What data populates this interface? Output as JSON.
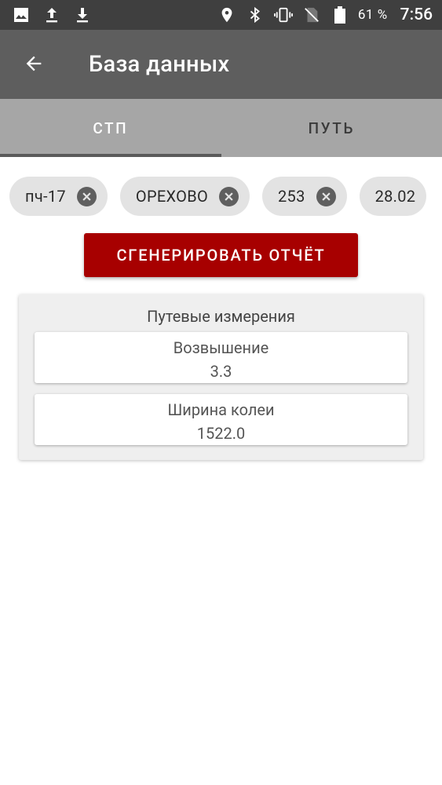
{
  "status_bar": {
    "battery_percent": "61 %",
    "time": "7:56",
    "icons": [
      "image-icon",
      "upload-icon",
      "download-icon",
      "location-icon",
      "bluetooth-icon",
      "vibrate-icon",
      "no-sim-icon",
      "battery-icon"
    ]
  },
  "app_bar": {
    "title": "База данных"
  },
  "tabs": [
    {
      "label": "СТП",
      "active": true
    },
    {
      "label": "ПУТЬ",
      "active": false
    }
  ],
  "chips": [
    {
      "label": "пч-17"
    },
    {
      "label": "ОРЕХОВО"
    },
    {
      "label": "253"
    },
    {
      "label": "28.02"
    }
  ],
  "generate_button": {
    "label": "СГЕНЕРИРОВАТЬ ОТЧЁТ"
  },
  "measurements": {
    "title": "Путевые измерения",
    "rows": [
      {
        "label": "Возвышение",
        "value": "3.3"
      },
      {
        "label": "Ширина колеи",
        "value": "1522.0"
      }
    ]
  },
  "colors": {
    "status_bar": "#3f3f3f",
    "app_bar": "#5e5e5e",
    "tabs": "#a6a6a6",
    "accent_button": "#a70000",
    "chip_bg": "#e3e3e3",
    "card_bg": "#efefef"
  }
}
